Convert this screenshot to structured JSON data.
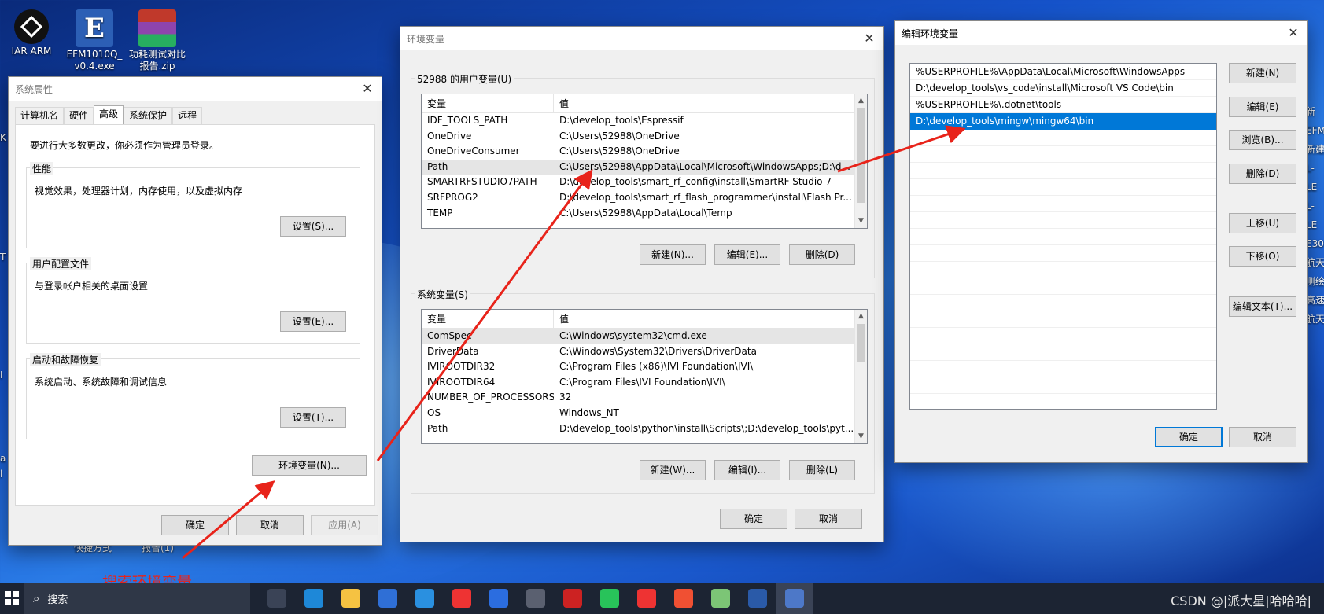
{
  "desktop": {
    "icons": [
      {
        "label": "IAR ARM"
      },
      {
        "label": "EFM1010Q_ v0.4.exe"
      },
      {
        "label": "功耗测试对比 报告.zip"
      }
    ],
    "bottom_labels": [
      "快捷方式",
      "报告(1)"
    ],
    "right_edge_labels": [
      "新",
      "EFM",
      "新建",
      "L-LE",
      "L-LE",
      "E30",
      "航天",
      "测绘",
      "高速",
      "航天"
    ],
    "left_edge_labels": [
      "K",
      "T",
      "I",
      "a",
      "l"
    ],
    "annotation": "搜索环境变量",
    "watermark": "CSDN @|派大星|哈哈哈|"
  },
  "sysprops": {
    "title": "系统属性",
    "tabs": [
      "计算机名",
      "硬件",
      "高级",
      "系统保护",
      "远程"
    ],
    "active_tab": "高级",
    "admin_note": "要进行大多数更改，你必须作为管理员登录。",
    "groups": [
      {
        "label": "性能",
        "desc": "视觉效果，处理器计划，内存使用，以及虚拟内存",
        "button": "设置(S)..."
      },
      {
        "label": "用户配置文件",
        "desc": "与登录帐户相关的桌面设置",
        "button": "设置(E)..."
      },
      {
        "label": "启动和故障恢复",
        "desc": "系统启动、系统故障和调试信息",
        "button": "设置(T)..."
      }
    ],
    "env_button": "环境变量(N)...",
    "ok": "确定",
    "cancel": "取消",
    "apply": "应用(A)"
  },
  "envvars": {
    "title": "环境变量",
    "user_group": "52988 的用户变量(U)",
    "col_var": "变量",
    "col_val": "值",
    "user_rows": [
      {
        "name": "IDF_TOOLS_PATH",
        "value": "D:\\develop_tools\\Espressif"
      },
      {
        "name": "OneDrive",
        "value": "C:\\Users\\52988\\OneDrive"
      },
      {
        "name": "OneDriveConsumer",
        "value": "C:\\Users\\52988\\OneDrive"
      },
      {
        "name": "Path",
        "value": "C:\\Users\\52988\\AppData\\Local\\Microsoft\\WindowsApps;D:\\d..."
      },
      {
        "name": "SMARTRFSTUDIO7PATH",
        "value": "D:\\develop_tools\\smart_rf_config\\install\\SmartRF Studio 7"
      },
      {
        "name": "SRFPROG2",
        "value": "D:\\develop_tools\\smart_rf_flash_programmer\\install\\Flash Pr..."
      },
      {
        "name": "TEMP",
        "value": "C:\\Users\\52988\\AppData\\Local\\Temp"
      }
    ],
    "user_buttons": [
      "新建(N)...",
      "编辑(E)...",
      "删除(D)"
    ],
    "sys_group": "系统变量(S)",
    "sys_rows": [
      {
        "name": "ComSpec",
        "value": "C:\\Windows\\system32\\cmd.exe"
      },
      {
        "name": "DriverData",
        "value": "C:\\Windows\\System32\\Drivers\\DriverData"
      },
      {
        "name": "IVIROOTDIR32",
        "value": "C:\\Program Files (x86)\\IVI Foundation\\IVI\\"
      },
      {
        "name": "IVIROOTDIR64",
        "value": "C:\\Program Files\\IVI Foundation\\IVI\\"
      },
      {
        "name": "NUMBER_OF_PROCESSORS",
        "value": "32"
      },
      {
        "name": "OS",
        "value": "Windows_NT"
      },
      {
        "name": "Path",
        "value": "D:\\develop_tools\\python\\install\\Scripts\\;D:\\develop_tools\\pyt..."
      }
    ],
    "sys_buttons": [
      "新建(W)...",
      "编辑(I)...",
      "删除(L)"
    ],
    "ok": "确定",
    "cancel": "取消"
  },
  "editenv": {
    "title": "编辑环境变量",
    "entries": [
      "%USERPROFILE%\\AppData\\Local\\Microsoft\\WindowsApps",
      "D:\\develop_tools\\vs_code\\install\\Microsoft VS Code\\bin",
      "%USERPROFILE%\\.dotnet\\tools",
      "D:\\develop_tools\\mingw\\mingw64\\bin"
    ],
    "selected_index": 3,
    "buttons": [
      "新建(N)",
      "编辑(E)",
      "浏览(B)...",
      "删除(D)",
      "上移(U)",
      "下移(O)",
      "编辑文本(T)..."
    ],
    "ok": "确定",
    "cancel": "取消"
  },
  "taskbar": {
    "search_placeholder": "搜索",
    "apps": [
      "task-view",
      "edge",
      "file-explorer",
      "store",
      "vscode",
      "wps",
      "docs",
      "calculator",
      "atk-xcom",
      "wechat",
      "wps-2",
      "git",
      "notepad",
      "powershell",
      "remote"
    ]
  },
  "colors": {
    "accent": "#0078d7",
    "selection": "#0078d7",
    "arrow": "#e8231a",
    "annotation": "#e8231a"
  }
}
